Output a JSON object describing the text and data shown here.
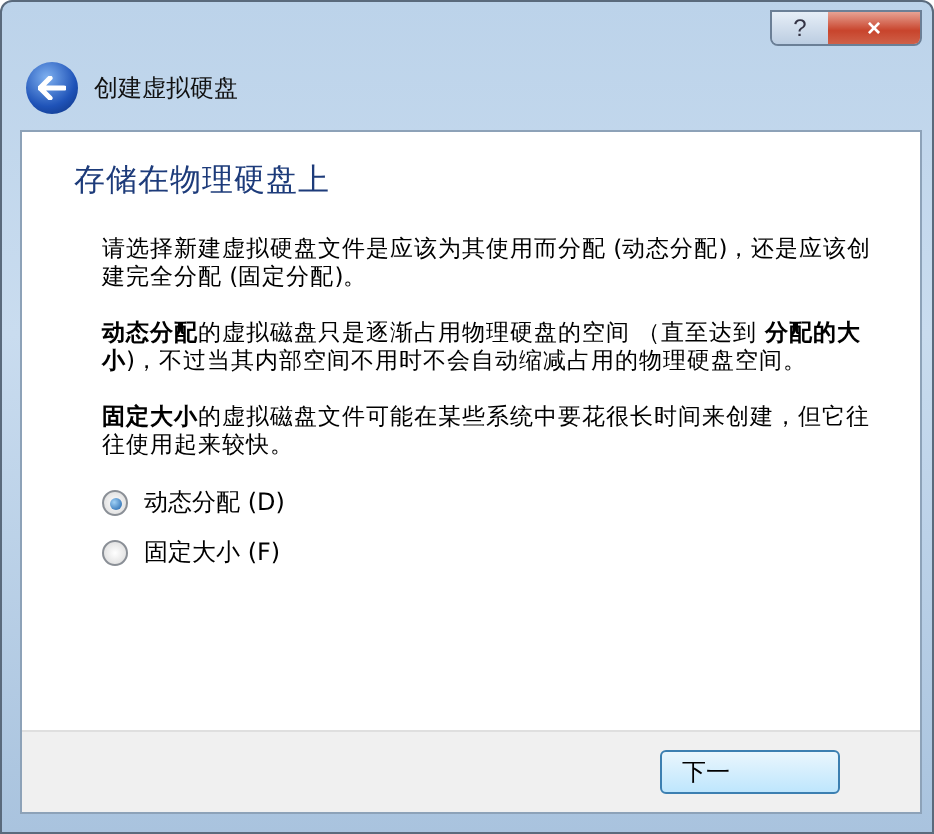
{
  "window": {
    "help_button": "?",
    "close_button": "×"
  },
  "wizard": {
    "title": "创建虚拟硬盘",
    "heading": "存储在物理硬盘上",
    "paragraphs": [
      "请选择新建虚拟硬盘文件是应该为其使用而分配 (动态分配)，还是应该创建完全分配 (固定分配)。",
      "**动态分配**的虚拟磁盘只是逐渐占用物理硬盘的空间 （直至达到 **分配的大小**)，不过当其内部空间不用时不会自动缩减占用的物理硬盘空间。",
      "**固定大小**的虚拟磁盘文件可能在某些系统中要花很长时间来创建，但它往往使用起来较快。"
    ],
    "options": [
      {
        "label": "动态分配 (D)",
        "selected": true
      },
      {
        "label": "固定大小 (F)",
        "selected": false
      }
    ],
    "buttons": [
      "下一"
    ]
  }
}
